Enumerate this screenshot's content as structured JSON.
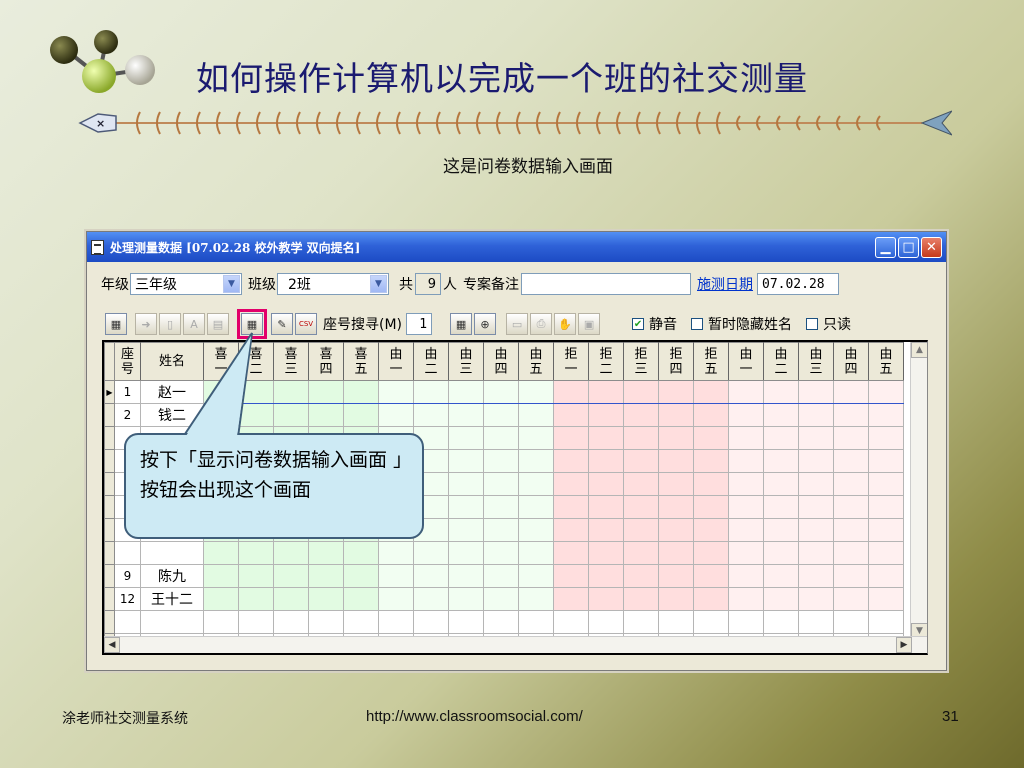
{
  "slide": {
    "title": "如何操作计算机以完成一个班的社交测量",
    "subtitle": "这是问卷数据输入画面",
    "footer_left": "涂老师社交测量系统",
    "footer_url": "http://www.classroomsocial.com/",
    "page_number": "31"
  },
  "window": {
    "title": "处理测量数据 [07.02.28 校外教学 双向提名]"
  },
  "form": {
    "grade_label": "年级",
    "grade_value": "三年级",
    "class_label": "班级",
    "class_value": "2班",
    "total_label": "共",
    "total_count": "9",
    "person_unit": "人",
    "notes_label": "专案备注",
    "notes_value": "",
    "date_link": "施测日期",
    "date_value": "07.02.28"
  },
  "toolbar": {
    "seat_search_label": "座号搜寻(M)",
    "seat_search_value": "1",
    "mute_label": "静音",
    "mute_checked": true,
    "hide_names_label": "暂时隐藏姓名",
    "hide_names_checked": false,
    "readonly_label": "只读",
    "readonly_checked": false,
    "csv_label": "CSV"
  },
  "grid": {
    "columns": [
      [
        "座",
        "号"
      ],
      [
        "姓名"
      ],
      [
        "喜",
        "一"
      ],
      [
        "喜",
        "二"
      ],
      [
        "喜",
        "三"
      ],
      [
        "喜",
        "四"
      ],
      [
        "喜",
        "五"
      ],
      [
        "由",
        "一"
      ],
      [
        "由",
        "二"
      ],
      [
        "由",
        "三"
      ],
      [
        "由",
        "四"
      ],
      [
        "由",
        "五"
      ],
      [
        "拒",
        "一"
      ],
      [
        "拒",
        "二"
      ],
      [
        "拒",
        "三"
      ],
      [
        "拒",
        "四"
      ],
      [
        "拒",
        "五"
      ],
      [
        "由",
        "一"
      ],
      [
        "由",
        "二"
      ],
      [
        "由",
        "三"
      ],
      [
        "由",
        "四"
      ],
      [
        "由",
        "五"
      ]
    ],
    "rows": [
      [
        "1",
        "赵一"
      ],
      [
        "2",
        "钱二"
      ],
      [
        "",
        ""
      ],
      [
        "",
        ""
      ],
      [
        "",
        ""
      ],
      [
        "",
        ""
      ],
      [
        "",
        ""
      ],
      [
        "",
        ""
      ],
      [
        "9",
        "陈九"
      ],
      [
        "12",
        "王十二"
      ],
      [
        "",
        ""
      ],
      [
        "",
        ""
      ]
    ]
  },
  "callout": {
    "text": "按下「显示问卷数据输入画面 」按钮会出现这个画面"
  },
  "colors": {
    "like": "#e2fbe2",
    "reason": "#f2fef2",
    "reject": "#ffdede",
    "reject_reason": "#fff0f0",
    "highlight": "#e2006a",
    "titlebar": "#2f62d8"
  }
}
